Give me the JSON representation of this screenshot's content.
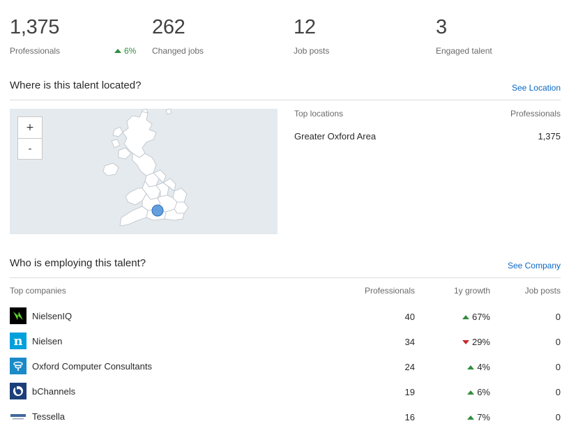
{
  "stats": [
    {
      "value": "1,375",
      "label": "Professionals",
      "change": "6%"
    },
    {
      "value": "262",
      "label": "Changed jobs"
    },
    {
      "value": "12",
      "label": "Job posts"
    },
    {
      "value": "3",
      "label": "Engaged talent"
    }
  ],
  "location_section": {
    "title": "Where is this talent located?",
    "link": "See Location",
    "zoom_in": "+",
    "zoom_out": "-",
    "headers": {
      "left": "Top locations",
      "right": "Professionals"
    },
    "rows": [
      {
        "name": "Greater Oxford Area",
        "count": "1,375"
      }
    ]
  },
  "company_section": {
    "title": "Who is employing this talent?",
    "link": "See Company",
    "headers": {
      "company": "Top companies",
      "professionals": "Professionals",
      "growth": "1y growth",
      "jobs": "Job posts"
    },
    "rows": [
      {
        "name": "NielsenIQ",
        "professionals": "40",
        "growth": "67%",
        "direction": "up",
        "jobs": "0"
      },
      {
        "name": "Nielsen",
        "professionals": "34",
        "growth": "29%",
        "direction": "down",
        "jobs": "0"
      },
      {
        "name": "Oxford Computer Consultants",
        "professionals": "24",
        "growth": "4%",
        "direction": "up",
        "jobs": "0"
      },
      {
        "name": "bChannels",
        "professionals": "19",
        "growth": "6%",
        "direction": "up",
        "jobs": "0"
      },
      {
        "name": "Tessella",
        "professionals": "16",
        "growth": "7%",
        "direction": "up",
        "jobs": "0"
      }
    ]
  },
  "colors": {
    "link": "#0a66c2",
    "up": "#2f8d3d",
    "down": "#c4282b",
    "map_bg": "#e5eaee",
    "map_marker": "#4a90d9"
  }
}
